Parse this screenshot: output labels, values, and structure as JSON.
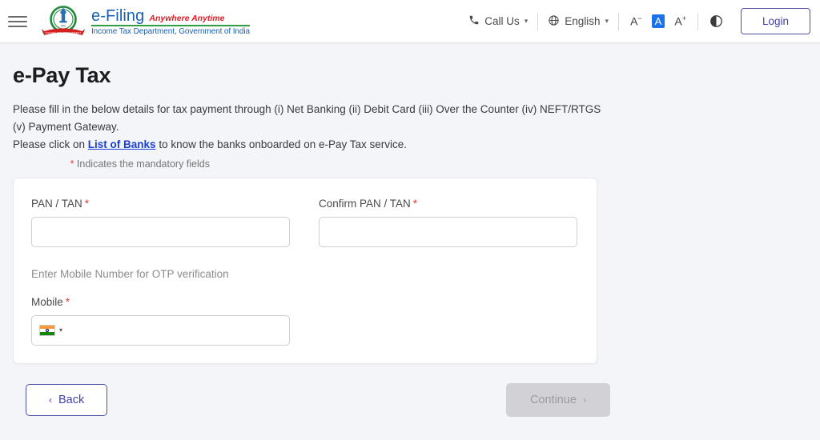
{
  "header": {
    "menu_icon": "hamburger-menu-icon",
    "brand": {
      "emblem_icon": "india-income-tax-emblem",
      "name": "e-Filing",
      "tagline": "Anywhere Anytime",
      "subtitle": "Income Tax Department, Government of India"
    },
    "call_us": {
      "icon": "phone-icon",
      "label": "Call Us",
      "caret": "⌄"
    },
    "language": {
      "icon": "globe-icon",
      "label": "English",
      "caret": "⌄"
    },
    "font_size": {
      "decrease": "A",
      "decrease_sup": "−",
      "normal": "A",
      "increase": "A",
      "increase_sup": "+"
    },
    "contrast_icon": "contrast-toggle-icon",
    "login_label": "Login"
  },
  "page": {
    "title": "e-Pay Tax",
    "description_line1": "Please fill in the below details for tax payment through (i) Net Banking (ii) Debit Card (iii) Over the Counter (iv) NEFT/RTGS (v) Payment Gateway.",
    "description_prefix": "Please click on ",
    "list_of_banks_link": "List of Banks",
    "description_suffix": " to know the banks onboarded on e-Pay Tax service.",
    "mandatory_star": "*",
    "mandatory_note": " Indicates the mandatory fields"
  },
  "form": {
    "pan": {
      "label": "PAN / TAN",
      "required_star": "*",
      "value": "",
      "placeholder": ""
    },
    "confirm_pan": {
      "label": "Confirm PAN / TAN",
      "required_star": "*",
      "value": "",
      "placeholder": ""
    },
    "otp_note": "Enter Mobile Number for OTP verification",
    "mobile": {
      "label": "Mobile",
      "required_star": "*",
      "value": "",
      "placeholder": "",
      "country_flag": "india-flag-icon",
      "country_caret": "▾"
    }
  },
  "actions": {
    "back_label": "Back",
    "back_chevron": "‹",
    "continue_label": "Continue",
    "continue_chevron": "›"
  },
  "colors": {
    "page_bg": "#f4f5f9",
    "brand_blue": "#1a5fb4",
    "brand_red": "#e01b24",
    "brand_green": "#2f9e44",
    "accent_indigo": "#3f44a3",
    "highlight_blue": "#1a73e8",
    "link_blue": "#1a3fd4",
    "required_red": "#e23b3b",
    "disabled_gray": "#d2d2d6"
  }
}
